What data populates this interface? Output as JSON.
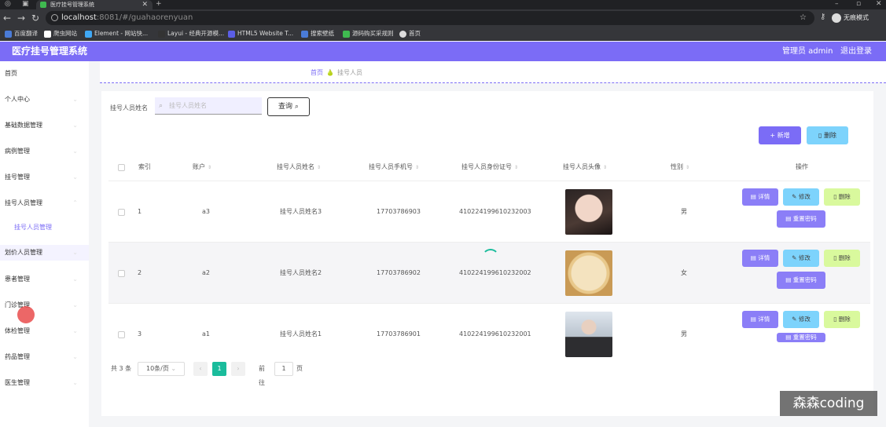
{
  "browser": {
    "tab_title": "医疗挂号管理系统",
    "url_host": "localhost",
    "url_port_path": ":8081/#/guahaorenyuan",
    "incognito_label": "无痕模式",
    "bookmarks": [
      {
        "label": "百度翻译",
        "color": "#4a7bd8"
      },
      {
        "label": "爬虫网站",
        "color": "#ffffff"
      },
      {
        "label": "Element - 网站快...",
        "color": "#3fa8f5"
      },
      {
        "label": "Layui - 经典开源模...",
        "color": "#333333"
      },
      {
        "label": "HTML5 Website T...",
        "color": "#5b5ee6"
      },
      {
        "label": "搜索壁纸",
        "color": "#4a7bd8"
      },
      {
        "label": "源码购买采规则",
        "color": "#3fb950"
      },
      {
        "label": "首页",
        "color": "#dddddd"
      }
    ]
  },
  "header": {
    "app_title": "医疗挂号管理系统",
    "user_label": "管理员 admin",
    "logout_label": "退出登录",
    "accent": "#7b6cf6"
  },
  "sidebar": {
    "items": [
      {
        "label": "首页",
        "chevron": ""
      },
      {
        "label": "个人中心",
        "chevron": "⌄"
      },
      {
        "label": "基础数据管理",
        "chevron": "⌄"
      },
      {
        "label": "病例管理",
        "chevron": "⌄"
      },
      {
        "label": "挂号管理",
        "chevron": "⌄"
      },
      {
        "label": "挂号人员管理",
        "chevron": "⌃"
      },
      {
        "label": "挂号人员管理",
        "chevron": ""
      },
      {
        "label": "划价人员管理",
        "chevron": "⌄"
      },
      {
        "label": "患者管理",
        "chevron": "⌄"
      },
      {
        "label": "门诊管理",
        "chevron": "⌄"
      },
      {
        "label": "体检管理",
        "chevron": "⌄"
      },
      {
        "label": "药品管理",
        "chevron": "⌄"
      },
      {
        "label": "医生管理",
        "chevron": "⌄"
      }
    ]
  },
  "breadcrumb": {
    "home": "首页",
    "current": "挂号人员"
  },
  "search": {
    "label": "挂号人员姓名",
    "placeholder": "挂号人员姓名",
    "button": "查询"
  },
  "actions": {
    "add": "新增",
    "delete": "删除"
  },
  "table": {
    "columns": [
      "索引",
      "账户",
      "挂号人员姓名",
      "挂号人员手机号",
      "挂号人员身份证号",
      "挂号人员头像",
      "性别",
      "操作"
    ],
    "rows": [
      {
        "index": "1",
        "account": "a3",
        "name": "挂号人员姓名3",
        "phone": "17703786903",
        "id_card": "410224199610232003",
        "avatar": "woman-photo",
        "gender": "男"
      },
      {
        "index": "2",
        "account": "a2",
        "name": "挂号人员姓名2",
        "phone": "17703786902",
        "id_card": "410224199610232002",
        "avatar": "puppy-photo",
        "gender": "女"
      },
      {
        "index": "3",
        "account": "a1",
        "name": "挂号人员姓名1",
        "phone": "17703786901",
        "id_card": "410224199610232001",
        "avatar": "person-photo",
        "gender": "男"
      }
    ],
    "row_actions": {
      "detail": "详情",
      "edit": "修改",
      "delete": "删除",
      "reset_password": "重置密码"
    }
  },
  "pagination": {
    "total": "共 3 条",
    "page_size": "10条/页",
    "current_page": "1",
    "goto_label": "前往",
    "goto_value": "1",
    "goto_unit": "页"
  },
  "watermark": "森森coding"
}
